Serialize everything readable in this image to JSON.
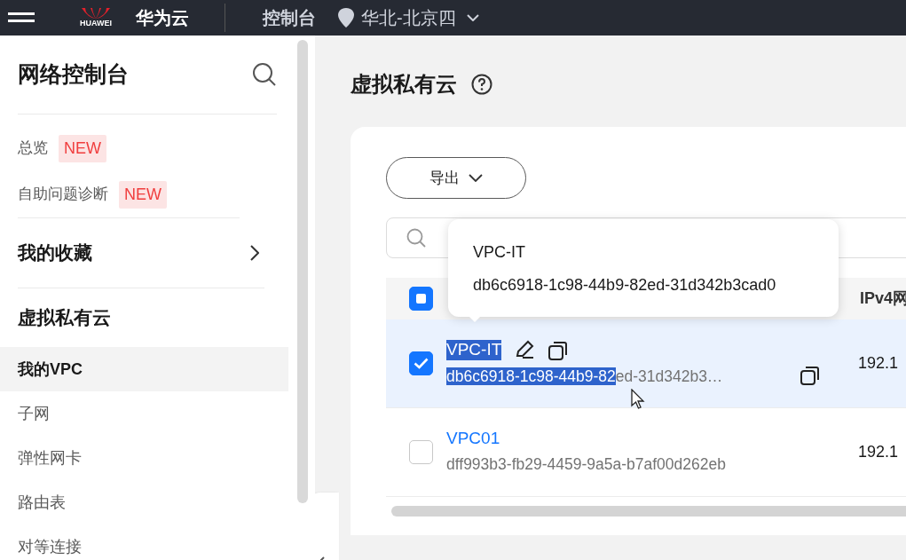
{
  "top_bar": {
    "brand": "HUAWEI",
    "product": "华为云",
    "console": "控制台",
    "region": "华北-北京四"
  },
  "sidebar": {
    "title": "网络控制台",
    "links": [
      {
        "label": "总览",
        "badge": "NEW"
      },
      {
        "label": "自助问题诊断",
        "badge": "NEW"
      }
    ],
    "favorites": {
      "label": "我的收藏"
    },
    "section": {
      "title": "虚拟私有云",
      "items": [
        {
          "label": "我的VPC",
          "selected": true
        },
        {
          "label": "子网",
          "selected": false
        },
        {
          "label": "弹性网卡",
          "selected": false
        },
        {
          "label": "路由表",
          "selected": false
        },
        {
          "label": "对等连接",
          "selected": false
        }
      ]
    }
  },
  "page": {
    "title": "虚拟私有云"
  },
  "export_button": "导出",
  "tooltip": {
    "name": "VPC-IT",
    "id": "db6c6918-1c98-44b9-82ed-31d342b3cad0"
  },
  "table": {
    "header_partial": true,
    "columns": [
      {
        "label": "IPv4网"
      }
    ],
    "rows": [
      {
        "selected": true,
        "hovered": true,
        "name": "VPC-IT",
        "name_highlighted": true,
        "id_parts": [
          {
            "text": "db6c6918-1c98-44b9-82",
            "highlighted": true
          },
          {
            "text": "ed-31d342b3…",
            "highlighted": false
          }
        ],
        "ipv4": "192.1"
      },
      {
        "selected": false,
        "hovered": false,
        "name": "VPC01",
        "name_highlighted": false,
        "id_parts": [
          {
            "text": "dff993b3-fb29-4459-9a5a-b7af00d262eb",
            "highlighted": false
          }
        ],
        "ipv4": "192.1"
      }
    ]
  }
}
